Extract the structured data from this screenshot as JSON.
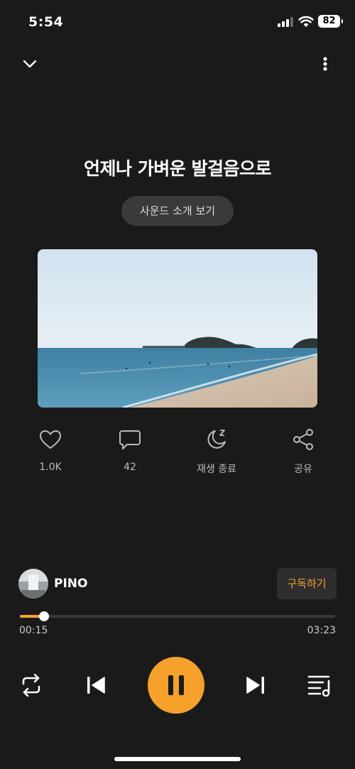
{
  "status_bar": {
    "time": "5:54",
    "battery": "82"
  },
  "top_bar": {
    "collapse_icon": "chevron-down-icon",
    "more_icon": "more-vertical-icon"
  },
  "song": {
    "title": "언제나 가벼운 발걸음으로",
    "intro_button": "사운드 소개 보기"
  },
  "album_art": {
    "description_icon": "album-art-image"
  },
  "actions": [
    {
      "icon": "heart-icon",
      "label": "1.0K"
    },
    {
      "icon": "comment-icon",
      "label": "42"
    },
    {
      "icon": "sleep-timer-icon",
      "label": "재생 종료"
    },
    {
      "icon": "share-icon",
      "label": "공유"
    }
  ],
  "artist": {
    "name": "PINO",
    "subscribe_label": "구독하기"
  },
  "playback": {
    "current_time": "00:15",
    "total_time": "03:23",
    "progress": 0.077
  },
  "controls": {
    "repeat_icon": "repeat-icon",
    "prev_icon": "skip-previous-icon",
    "play_state": "playing",
    "next_icon": "skip-next-icon",
    "playlist_icon": "playlist-icon"
  },
  "colors": {
    "accent": "#f5a12c",
    "background": "#1a1a1a"
  }
}
